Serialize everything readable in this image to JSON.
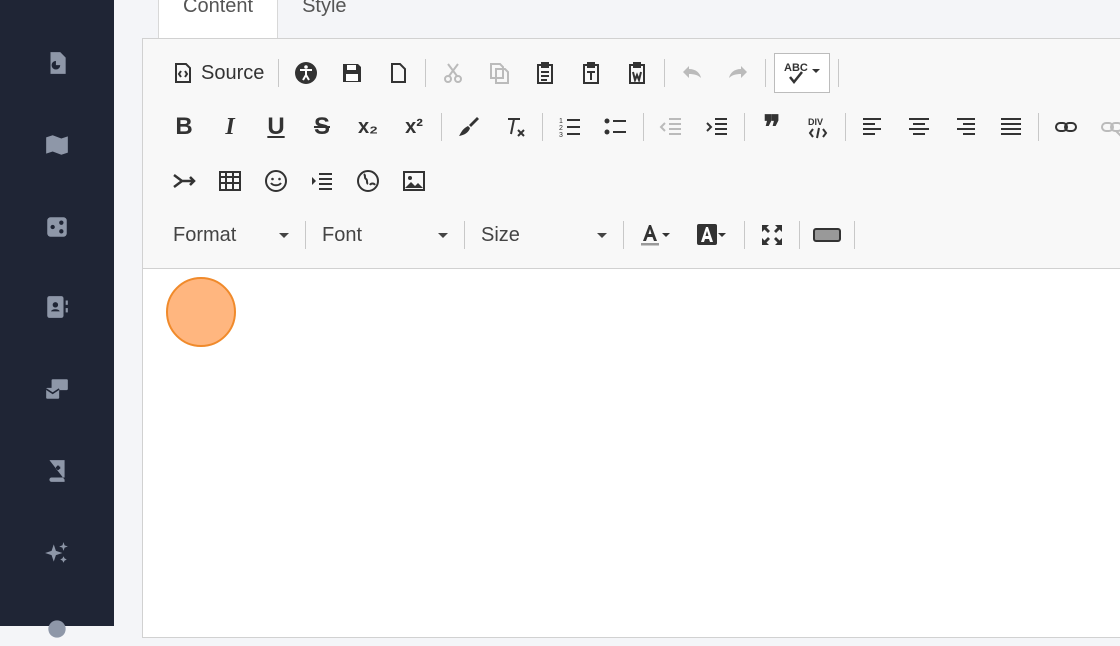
{
  "tabs": [
    {
      "label": "Content",
      "active": true
    },
    {
      "label": "Style",
      "active": false
    }
  ],
  "sidebar": {
    "items": [
      {
        "icon": "document-chart-icon"
      },
      {
        "icon": "map-icon"
      },
      {
        "icon": "share-icon"
      },
      {
        "icon": "contact-card-icon"
      },
      {
        "icon": "mail-stack-icon"
      },
      {
        "icon": "book-plus-icon"
      },
      {
        "icon": "sparkles-icon"
      },
      {
        "icon": "settings-icon"
      }
    ]
  },
  "toolbar": {
    "source_label": "Source",
    "format_label": "Format",
    "font_label": "Font",
    "size_label": "Size",
    "bold": "B",
    "italic": "I",
    "underline": "U",
    "strike": "S",
    "subscript": "x₂",
    "superscript": "x²",
    "spellcheck": "ABC",
    "blockquote": "❞",
    "div": "DIV"
  },
  "colors": {
    "sidebar_bg": "#1f2535",
    "toolbar_bg": "#f8f8f8",
    "cursor_fill": "#ffb67f",
    "cursor_border": "#f08a2b"
  }
}
